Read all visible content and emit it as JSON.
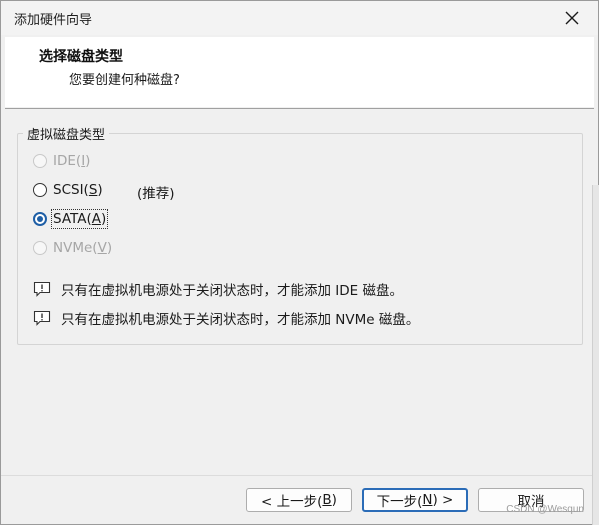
{
  "window": {
    "title": "添加硬件向导"
  },
  "header": {
    "title": "选择磁盘类型",
    "subtitle": "您要创建何种磁盘?"
  },
  "group": {
    "legend": "虚拟磁盘类型"
  },
  "options": [
    {
      "label": "IDE(",
      "mnemonic": "I",
      "suffix": ")",
      "enabled": false,
      "selected": false
    },
    {
      "label": "SCSI(",
      "mnemonic": "S",
      "suffix": ")",
      "enabled": true,
      "selected": false,
      "note": "(推荐)"
    },
    {
      "label": "SATA(",
      "mnemonic": "A",
      "suffix": ")",
      "enabled": true,
      "selected": true
    },
    {
      "label": "NVMe(",
      "mnemonic": "V",
      "suffix": ")",
      "enabled": false,
      "selected": false
    }
  ],
  "info": [
    {
      "icon": "info-message-icon",
      "text": "只有在虚拟机电源处于关闭状态时，才能添加 IDE 磁盘。"
    },
    {
      "icon": "info-message-icon",
      "text": "只有在虚拟机电源处于关闭状态时，才能添加 NVMe 磁盘。"
    }
  ],
  "buttons": {
    "back": {
      "pre": "< 上一步(",
      "mnemonic": "B",
      "post": ")"
    },
    "next": {
      "pre": "下一步(",
      "mnemonic": "N",
      "post": ") >"
    },
    "cancel": {
      "label": "取消"
    }
  },
  "watermark": "CSDN @Wesqun",
  "colors": {
    "accent": "#1f5fa6",
    "primary_border": "#2b6cb7",
    "disabled_text": "#a6a6a6"
  }
}
